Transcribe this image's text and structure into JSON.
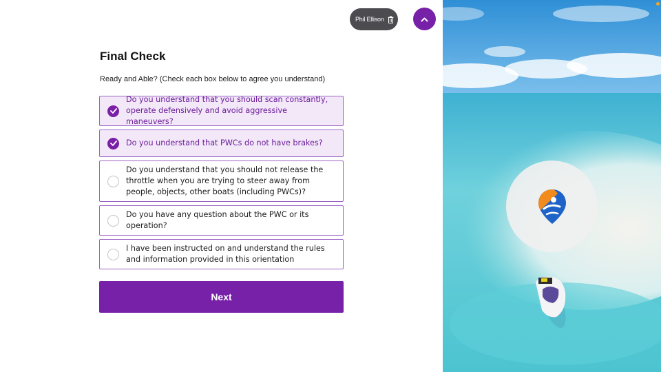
{
  "header": {
    "user_name": "Phil Ellison",
    "trash_icon": "trash-icon",
    "collapse_icon": "chevron-up-icon"
  },
  "form": {
    "title": "Final Check",
    "subtitle": "Ready and Able? (Check each box below to agree you understand)",
    "items": [
      {
        "label": "Do you understand that you should scan constantly, operate defensively and avoid aggressive maneuvers?",
        "checked": true
      },
      {
        "label": "Do you understand that PWCs do not have brakes?",
        "checked": true
      },
      {
        "label": "Do you understand that you should not release the throttle when you are trying to steer away from people, objects, other boats (including PWCs)?",
        "checked": false
      },
      {
        "label": "Do you have any question about the PWC or its operation?",
        "checked": false
      },
      {
        "label": "I have been instructed on and understand the rules and information provided in this orientation",
        "checked": false
      }
    ],
    "next_label": "Next"
  },
  "colors": {
    "accent": "#7720a8",
    "checked_bg": "#f3e8f8",
    "border": "#9b63c6",
    "chip_bg": "#4b4b50"
  },
  "hero": {
    "image": "beach-jetski-aerial-photo",
    "logo_icon": "location-pin-logo-icon"
  }
}
